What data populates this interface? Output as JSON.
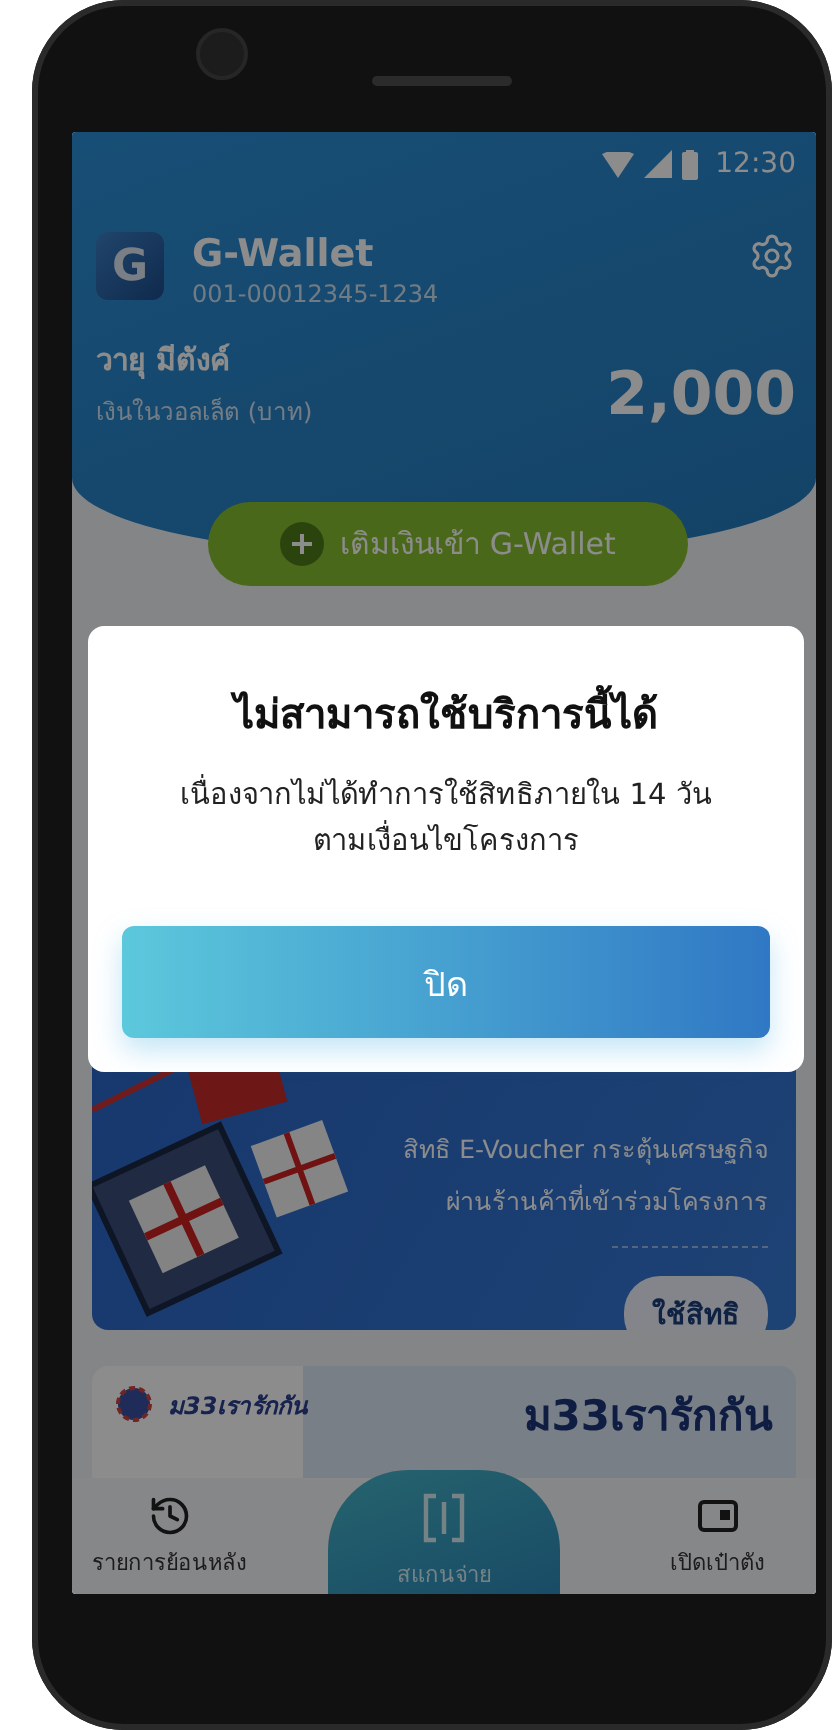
{
  "status_bar": {
    "time": "12:30"
  },
  "wallet": {
    "logo": "G",
    "title": "G-Wallet",
    "account": "001-00012345-1234",
    "owner": "วายุ มีตังค์",
    "balance_label": "เงินในวอลเล็ต (บาท)",
    "balance": "2,000",
    "top_up_button": "เติมเงินเข้า G-Wallet"
  },
  "voucher_card": {
    "lines": [
      "สิทธิ E-Voucher กระตุ้นเศรษฐกิจ",
      "ผ่านร้านค้าที่เข้าร่วมโครงการ"
    ],
    "button": "ใช้สิทธิ"
  },
  "promo_card": {
    "badge": "ม33เรารักกัน",
    "title": "ม33เรารักกัน"
  },
  "bottom_nav": [
    {
      "label": "รายการย้อนหลัง",
      "kind": "history"
    },
    {
      "label": "สแกนจ่าย",
      "kind": "scan"
    },
    {
      "label": "เปิดเป๋าตัง",
      "kind": "wallet"
    }
  ],
  "dialog": {
    "title": "ไม่สามารถใช้บริการนี้ได้",
    "message_lines": [
      "เนื่องจากไม่ได้ทำการใช้สิทธิภายใน 14 วัน",
      "ตามเงื่อนไขโครงการ"
    ],
    "button": "ปิด"
  }
}
